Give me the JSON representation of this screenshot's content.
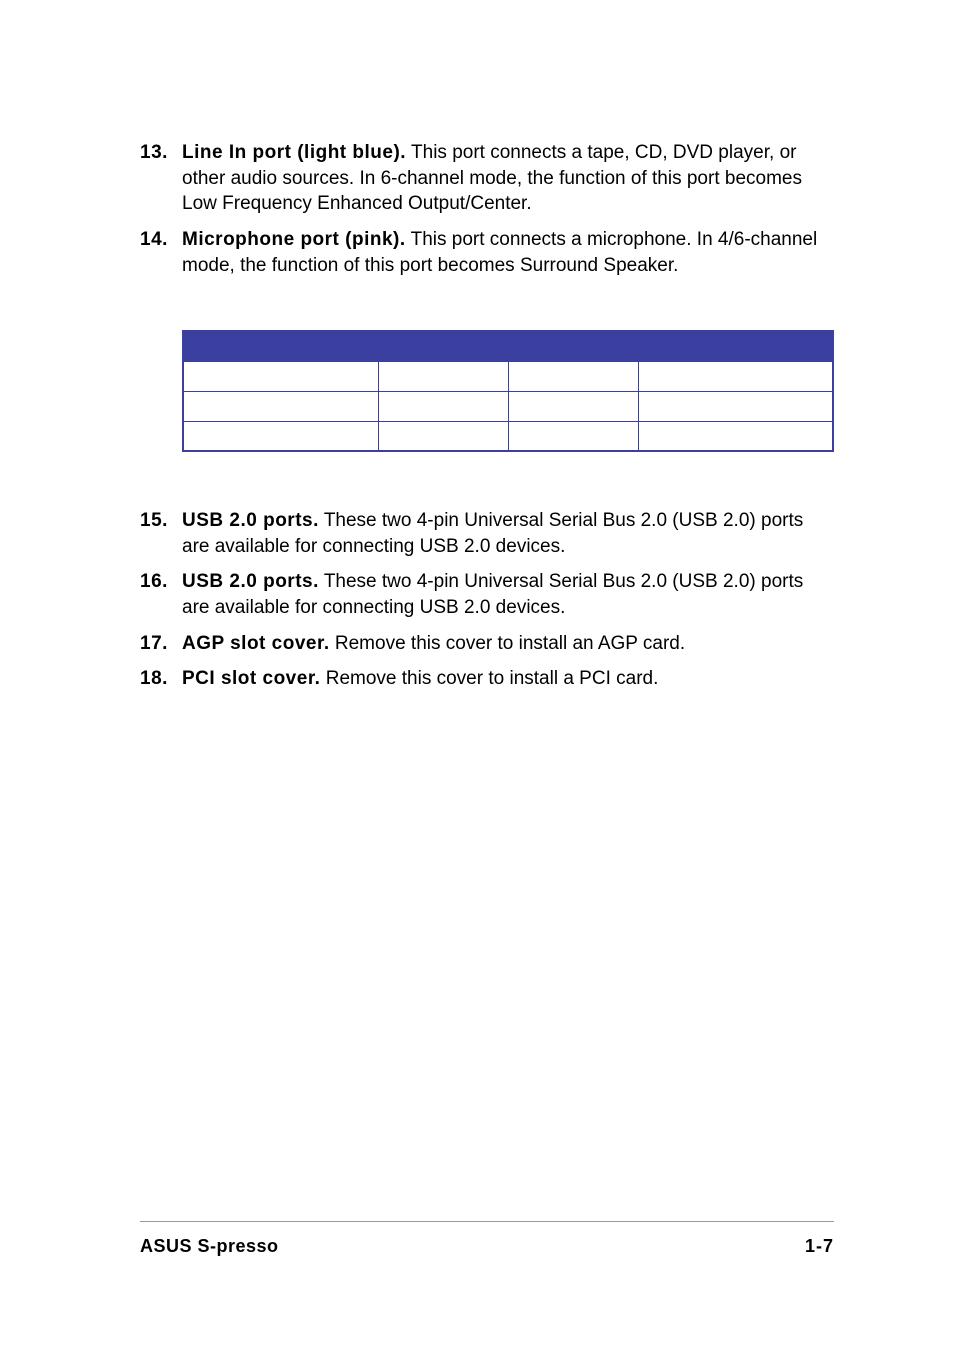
{
  "items_top": [
    {
      "num": "13.",
      "title": "Line In port (light blue).",
      "desc": "This port connects a tape, CD, DVD player, or other audio sources. In 6-channel mode, the function of this port becomes Low Frequency Enhanced Output/Center."
    },
    {
      "num": "14.",
      "title": "Microphone port (pink).",
      "desc": "This port connects a microphone. In 4/6-channel mode, the function of this port becomes Surround Speaker."
    }
  ],
  "items_bottom": [
    {
      "num": "15.",
      "title": "USB 2.0 ports.",
      "desc": "These two 4-pin Universal Serial Bus 2.0 (USB 2.0) ports are available for connecting USB 2.0 devices."
    },
    {
      "num": "16.",
      "title": "USB 2.0 ports.",
      "desc": "These two 4-pin Universal Serial Bus 2.0 (USB 2.0) ports are available for connecting USB 2.0 devices."
    },
    {
      "num": "17.",
      "title": "AGP slot cover.",
      "desc": "Remove this cover to install an AGP card."
    },
    {
      "num": "18.",
      "title": "PCI slot cover.",
      "desc": "Remove this cover to install a PCI card."
    }
  ],
  "table": {
    "header_cols": 4,
    "body_rows": 3,
    "body_cols": 4
  },
  "footer": {
    "left": "ASUS S-presso",
    "right": "1-7"
  },
  "colors": {
    "accent": "#3b3fa0"
  }
}
